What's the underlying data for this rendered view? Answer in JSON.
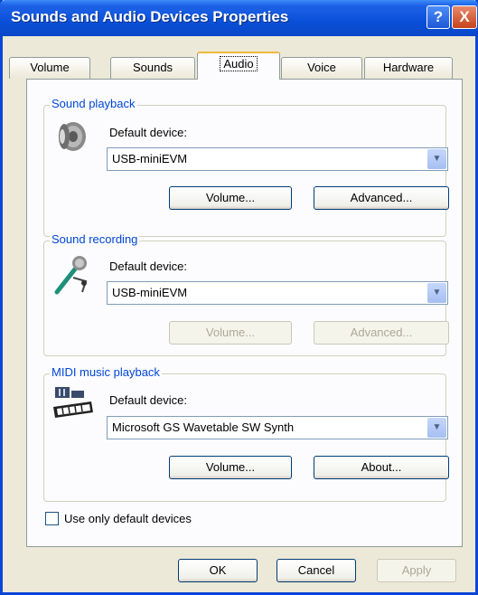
{
  "window": {
    "title": "Sounds and Audio Devices Properties",
    "help_glyph": "?",
    "close_glyph": "X"
  },
  "tabs": [
    {
      "label": "Volume",
      "active": false
    },
    {
      "label": "Sounds",
      "active": false
    },
    {
      "label": "Audio",
      "active": true
    },
    {
      "label": "Voice",
      "active": false
    },
    {
      "label": "Hardware",
      "active": false
    }
  ],
  "playback": {
    "legend": "Sound playback",
    "icon": "speaker-icon",
    "label": "Default device:",
    "value": "USB-miniEVM",
    "button1": "Volume...",
    "button2": "Advanced...",
    "buttons_enabled": true
  },
  "recording": {
    "legend": "Sound recording",
    "icon": "microphone-icon",
    "label": "Default device:",
    "value": "USB-miniEVM",
    "button1": "Volume...",
    "button2": "Advanced...",
    "buttons_enabled": false
  },
  "midi": {
    "legend": "MIDI music playback",
    "icon": "midi-keyboard-icon",
    "label": "Default device:",
    "value": "Microsoft GS Wavetable SW Synth",
    "button1": "Volume...",
    "button2": "About...",
    "buttons_enabled": true
  },
  "checkbox": {
    "label": "Use only default devices",
    "checked": false
  },
  "footer": {
    "ok": "OK",
    "cancel": "Cancel",
    "apply": "Apply",
    "apply_enabled": false
  },
  "colors": {
    "titlebar": "#0a4fd8",
    "legend": "#0046d5",
    "active_tab_accent": "#f0b83a"
  }
}
